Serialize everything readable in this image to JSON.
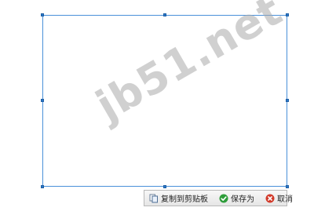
{
  "watermark": "jb51.net",
  "toolbar": {
    "copy_label": "复制到剪贴板",
    "save_label": "保存为",
    "cancel_label": "取消"
  },
  "colors": {
    "selection_border": "#4a90d9",
    "save_icon": "#2e9d3a",
    "cancel_icon": "#d23a2a"
  },
  "icons": {
    "copy": "copy-icon",
    "save": "check-icon",
    "cancel": "close-icon"
  }
}
